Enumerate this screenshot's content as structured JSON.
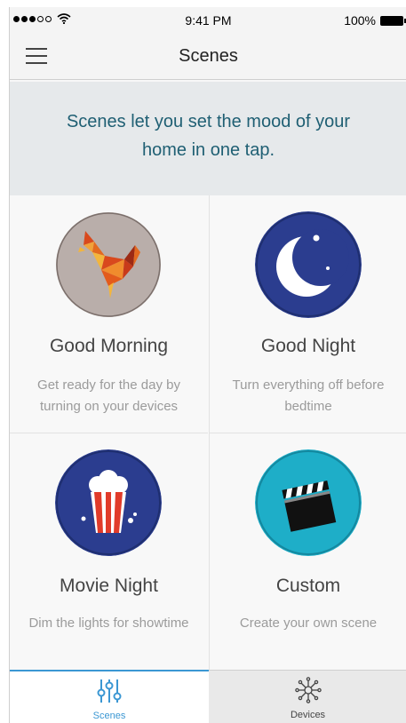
{
  "status_bar": {
    "signal_icon": "signal-dots-icon",
    "wifi_icon": "wifi-icon",
    "time": "9:41 PM",
    "battery": "100%",
    "battery_icon": "battery-icon"
  },
  "nav": {
    "title": "Scenes",
    "menu_icon": "hamburger-menu-icon"
  },
  "intro": {
    "line1": "Scenes let you set the mood of your",
    "line2": "home in one tap."
  },
  "scenes": [
    {
      "title": "Good Morning",
      "desc": "Get ready for the day by turning on your devices",
      "icon": "origami-rooster-icon"
    },
    {
      "title": "Good Night",
      "desc": "Turn everything off before bedtime",
      "icon": "crescent-moon-icon"
    },
    {
      "title": "Movie Night",
      "desc": "Dim the lights for showtime",
      "icon": "popcorn-icon"
    },
    {
      "title": "Custom",
      "desc": "Create your own scene",
      "icon": "clapperboard-icon"
    }
  ],
  "tabs": {
    "scenes": {
      "label": "Scenes",
      "icon": "sliders-icon",
      "active": true
    },
    "devices": {
      "label": "Devices",
      "icon": "network-hub-icon",
      "active": false
    }
  },
  "colors": {
    "accent": "#3b97d3",
    "intro_text": "#1f5f73",
    "intro_bg": "#e6e9eb",
    "moon_bg": "#2b3d8f",
    "popcorn_bg": "#2b3d8f",
    "clapper_bg": "#1eaec8"
  }
}
